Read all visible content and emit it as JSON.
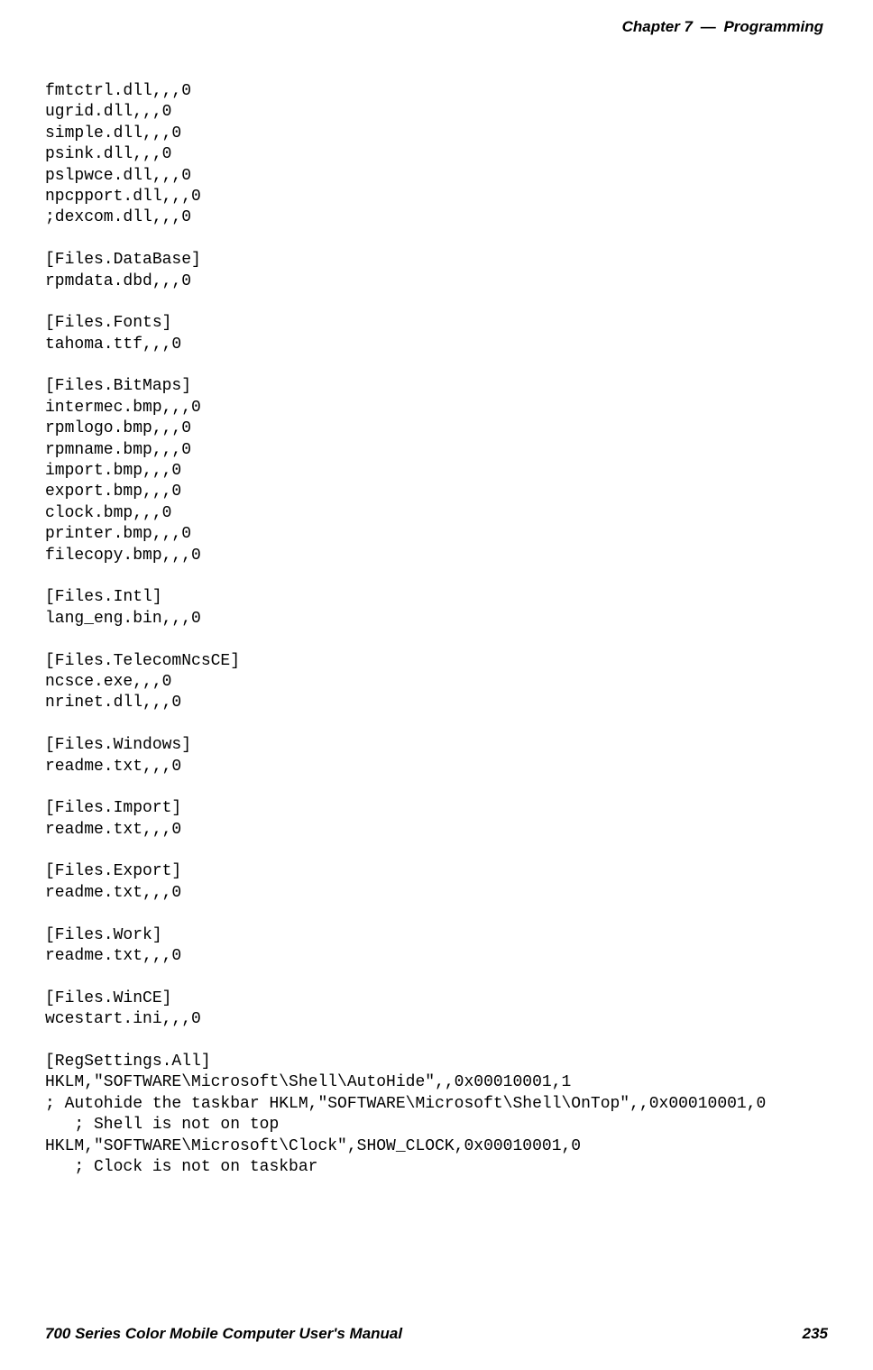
{
  "header": {
    "chapter": "Chapter 7",
    "title": "Programming"
  },
  "code": {
    "line1": "fmtctrl.dll,,,0",
    "line2": "ugrid.dll,,,0",
    "line3": "simple.dll,,,0",
    "line4": "psink.dll,,,0",
    "line5": "pslpwce.dll,,,0",
    "line6": "npcpport.dll,,,0",
    "line7": ";dexcom.dll,,,0",
    "line8": "",
    "line9": "[Files.DataBase]",
    "line10": "rpmdata.dbd,,,0",
    "line11": "",
    "line12": "[Files.Fonts]",
    "line13": "tahoma.ttf,,,0",
    "line14": "",
    "line15": "[Files.BitMaps]",
    "line16": "intermec.bmp,,,0",
    "line17": "rpmlogo.bmp,,,0",
    "line18": "rpmname.bmp,,,0",
    "line19": "import.bmp,,,0",
    "line20": "export.bmp,,,0",
    "line21": "clock.bmp,,,0",
    "line22": "printer.bmp,,,0",
    "line23": "filecopy.bmp,,,0",
    "line24": "",
    "line25": "[Files.Intl]",
    "line26": "lang_eng.bin,,,0",
    "line27": "",
    "line28": "[Files.TelecomNcsCE]",
    "line29": "ncsce.exe,,,0",
    "line30": "nrinet.dll,,,0",
    "line31": "",
    "line32": "[Files.Windows]",
    "line33": "readme.txt,,,0",
    "line34": "",
    "line35": "[Files.Import]",
    "line36": "readme.txt,,,0",
    "line37": "",
    "line38": "[Files.Export]",
    "line39": "readme.txt,,,0",
    "line40": "",
    "line41": "[Files.Work]",
    "line42": "readme.txt,,,0",
    "line43": "",
    "line44": "[Files.WinCE]",
    "line45": "wcestart.ini,,,0",
    "line46": "",
    "line47": "[RegSettings.All]",
    "line48": "HKLM,\"SOFTWARE\\Microsoft\\Shell\\AutoHide\",,0x00010001,1",
    "line49": "; Autohide the taskbar HKLM,\"SOFTWARE\\Microsoft\\Shell\\OnTop\",,0x00010001,0",
    "line50": "   ; Shell is not on top",
    "line51": "HKLM,\"SOFTWARE\\Microsoft\\Clock\",SHOW_CLOCK,0x00010001,0",
    "line52": "   ; Clock is not on taskbar"
  },
  "footer": {
    "left": "700 Series Color Mobile Computer User's Manual",
    "right": "235"
  }
}
